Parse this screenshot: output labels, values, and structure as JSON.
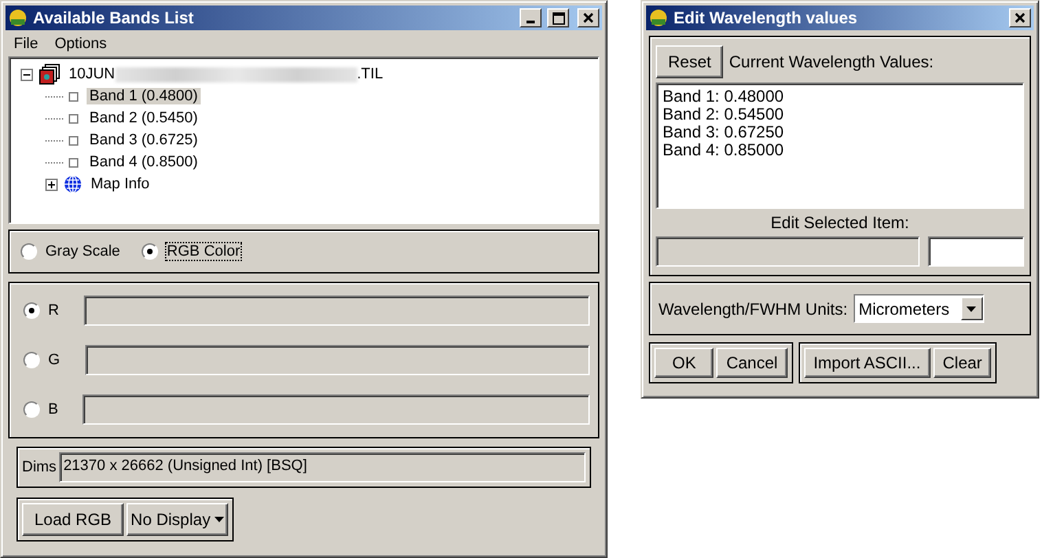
{
  "bands_window": {
    "title": "Available Bands List",
    "menu": [
      "File",
      "Options"
    ],
    "tree": [
      {
        "kind": "file",
        "prefix": "10JUN",
        "suffix": ".TIL",
        "expanded": true,
        "children": [
          {
            "kind": "band",
            "label": "Band 1 (0.4800)",
            "selected": true
          },
          {
            "kind": "band",
            "label": "Band 2 (0.5450)",
            "selected": false
          },
          {
            "kind": "band",
            "label": "Band 3 (0.6725)",
            "selected": false
          },
          {
            "kind": "band",
            "label": "Band 4 (0.8500)",
            "selected": false
          },
          {
            "kind": "map",
            "label": "Map Info",
            "expanded": false
          }
        ]
      }
    ],
    "modes": [
      {
        "label": "Gray Scale",
        "selected": false
      },
      {
        "label": "RGB Color",
        "selected": true
      }
    ],
    "channels": [
      {
        "label": "R",
        "selected": true
      },
      {
        "label": "G",
        "selected": false
      },
      {
        "label": "B",
        "selected": false
      }
    ],
    "dims": {
      "label": "Dims",
      "value": "21370 x 26662 (Unsigned Int) [BSQ]"
    },
    "load_button": "Load RGB",
    "display_menu": "No Display"
  },
  "wavelength_window": {
    "title": "Edit Wavelength values",
    "reset_button": "Reset",
    "list_label": "Current Wavelength Values:",
    "values": [
      "Band 1: 0.48000",
      "Band 2: 0.54500",
      "Band 3: 0.67250",
      "Band 4: 0.85000"
    ],
    "edit_label": "Edit Selected Item:",
    "units_label": "Wavelength/FWHM Units:",
    "units": "Micrometers",
    "button_groups": [
      [
        "OK",
        "Cancel"
      ],
      [
        "Import ASCII...",
        "Clear"
      ]
    ]
  }
}
